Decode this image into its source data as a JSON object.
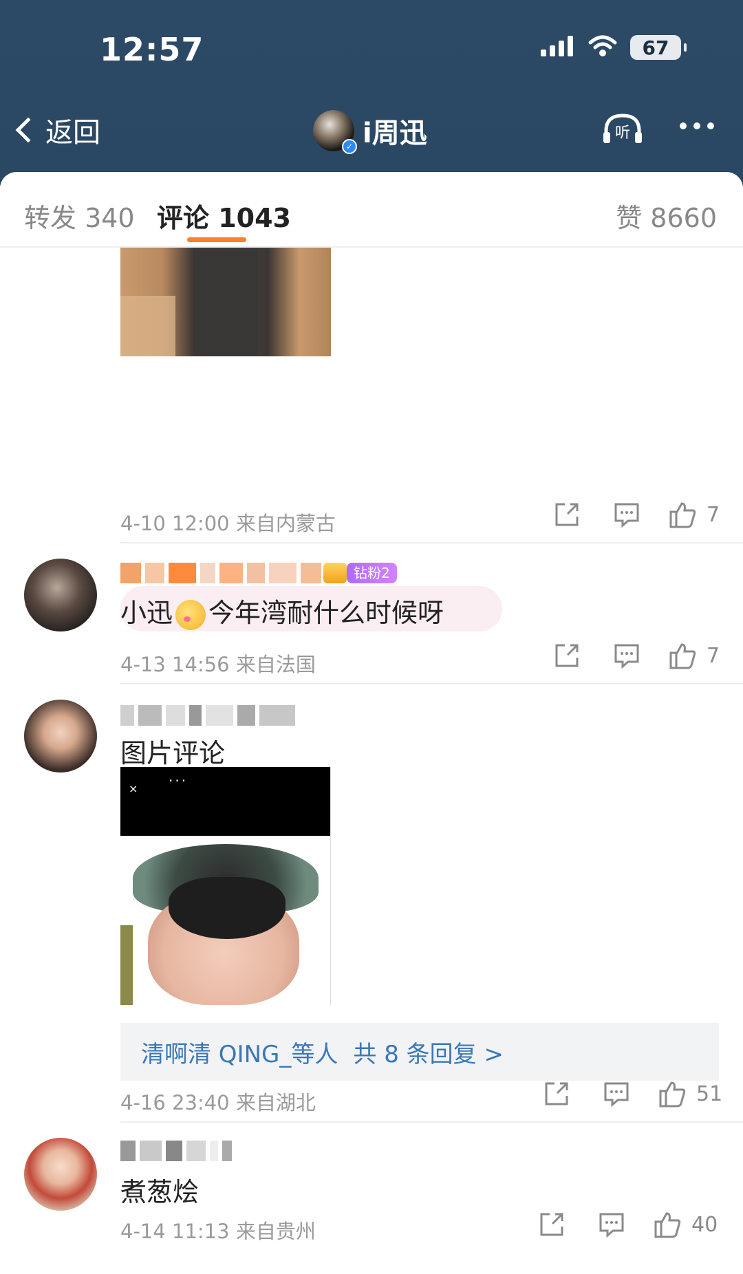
{
  "status_bar": {
    "time": "12:57",
    "battery": "67"
  },
  "nav": {
    "back_label": "返回",
    "title": "i周迅",
    "listen_label": "听"
  },
  "tabs": {
    "repost": "转发 340",
    "comments": "评论 1043",
    "likes": "赞 8660"
  },
  "comments": [
    {
      "meta": "4-10 12:00  来自内蒙古",
      "likes": "7"
    },
    {
      "badge": "钻粉2",
      "text_prefix": "小迅",
      "text_suffix": "今年湾耐什么时候呀",
      "meta": "4-13 14:56  来自法国",
      "likes": "7"
    },
    {
      "text": "图片评论",
      "replies_names": "清啊清 QING_等人",
      "replies_count": "共 8 条回复 >",
      "meta": "4-16 23:40  来自湖北",
      "likes": "51"
    },
    {
      "text": "煮葱烩",
      "meta": "4-14 11:13  来自贵州",
      "likes": "40"
    }
  ],
  "colors": {
    "header_bg": "#2c4a66",
    "accent_orange": "#ff7f2a",
    "link_blue": "#3a77b8"
  }
}
